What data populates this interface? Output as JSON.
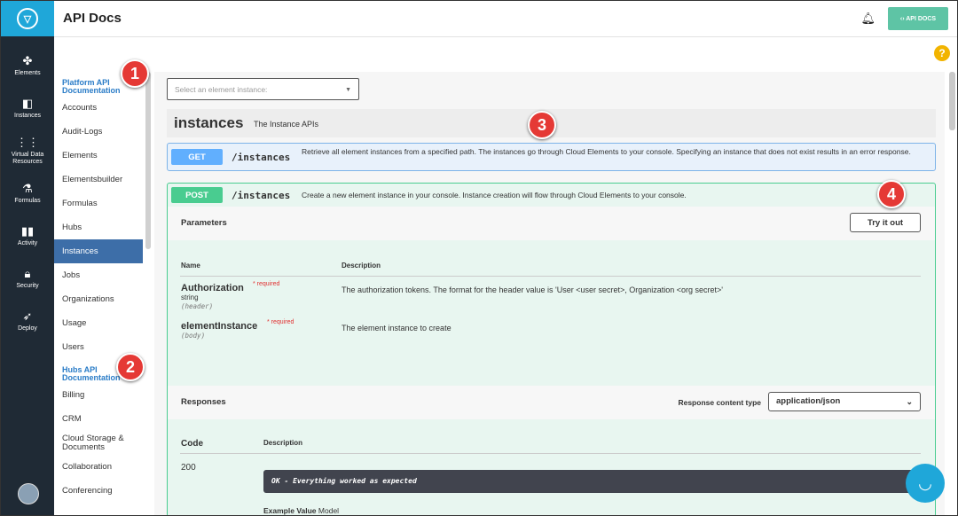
{
  "header": {
    "title": "API Docs",
    "apidocs_button": "‹› API DOCS"
  },
  "rail": [
    {
      "label": "Elements",
      "icon": "elements-icon"
    },
    {
      "label": "Instances",
      "icon": "instances-icon"
    },
    {
      "label": "Virtual Data Resources",
      "icon": "vdr-icon"
    },
    {
      "label": "Formulas",
      "icon": "formulas-icon"
    },
    {
      "label": "Activity",
      "icon": "activity-icon"
    },
    {
      "label": "Security",
      "icon": "lock-icon"
    },
    {
      "label": "Deploy",
      "icon": "rocket-icon"
    }
  ],
  "docnav": {
    "platform_heading": "Platform API Documentation",
    "platform_items": [
      "Accounts",
      "Audit-Logs",
      "Elements",
      "Elementsbuilder",
      "Formulas",
      "Hubs",
      "Instances",
      "Jobs",
      "Organizations",
      "Usage",
      "Users"
    ],
    "active_item": "Instances",
    "hubs_heading": "Hubs API Documentation",
    "hubs_items": [
      "Billing",
      "CRM",
      "Cloud Storage & Documents",
      "Collaboration",
      "Conferencing"
    ]
  },
  "main": {
    "select_placeholder": "Select an element instance:",
    "tag_name": "instances",
    "tag_desc": "The Instance APIs",
    "get": {
      "method": "GET",
      "path": "/instances",
      "desc": "Retrieve all element instances from a specified path. The instances go through Cloud Elements to your console. Specifying an instance that does not exist results in an error response."
    },
    "post": {
      "method": "POST",
      "path": "/instances",
      "desc": "Create a new element instance in your console. Instance creation will flow through Cloud Elements to your console.",
      "parameters_title": "Parameters",
      "try_button": "Try it out",
      "col_name": "Name",
      "col_desc": "Description",
      "params": [
        {
          "name": "Authorization",
          "required": "required",
          "type": "string",
          "in": "(header)",
          "desc": "The authorization tokens. The format for the header value is 'User <user secret>, Organization <org secret>'"
        },
        {
          "name": "elementInstance",
          "required": "required",
          "type": "",
          "in": "(body)",
          "desc": "The element instance to create"
        }
      ],
      "responses_title": "Responses",
      "response_type_label": "Response content type",
      "response_type_value": "application/json",
      "col_code": "Code",
      "col_rdesc": "Description",
      "code": "200",
      "code_desc": "OK - Everything worked as expected",
      "example_value": "Example Value",
      "model": "Model"
    }
  },
  "callouts": [
    "1",
    "2",
    "3",
    "4"
  ],
  "colors": {
    "accent": "#1fa7d9",
    "rail": "#1f2a35",
    "get": "#61affe",
    "post": "#49cc90",
    "callout": "#e53935"
  }
}
